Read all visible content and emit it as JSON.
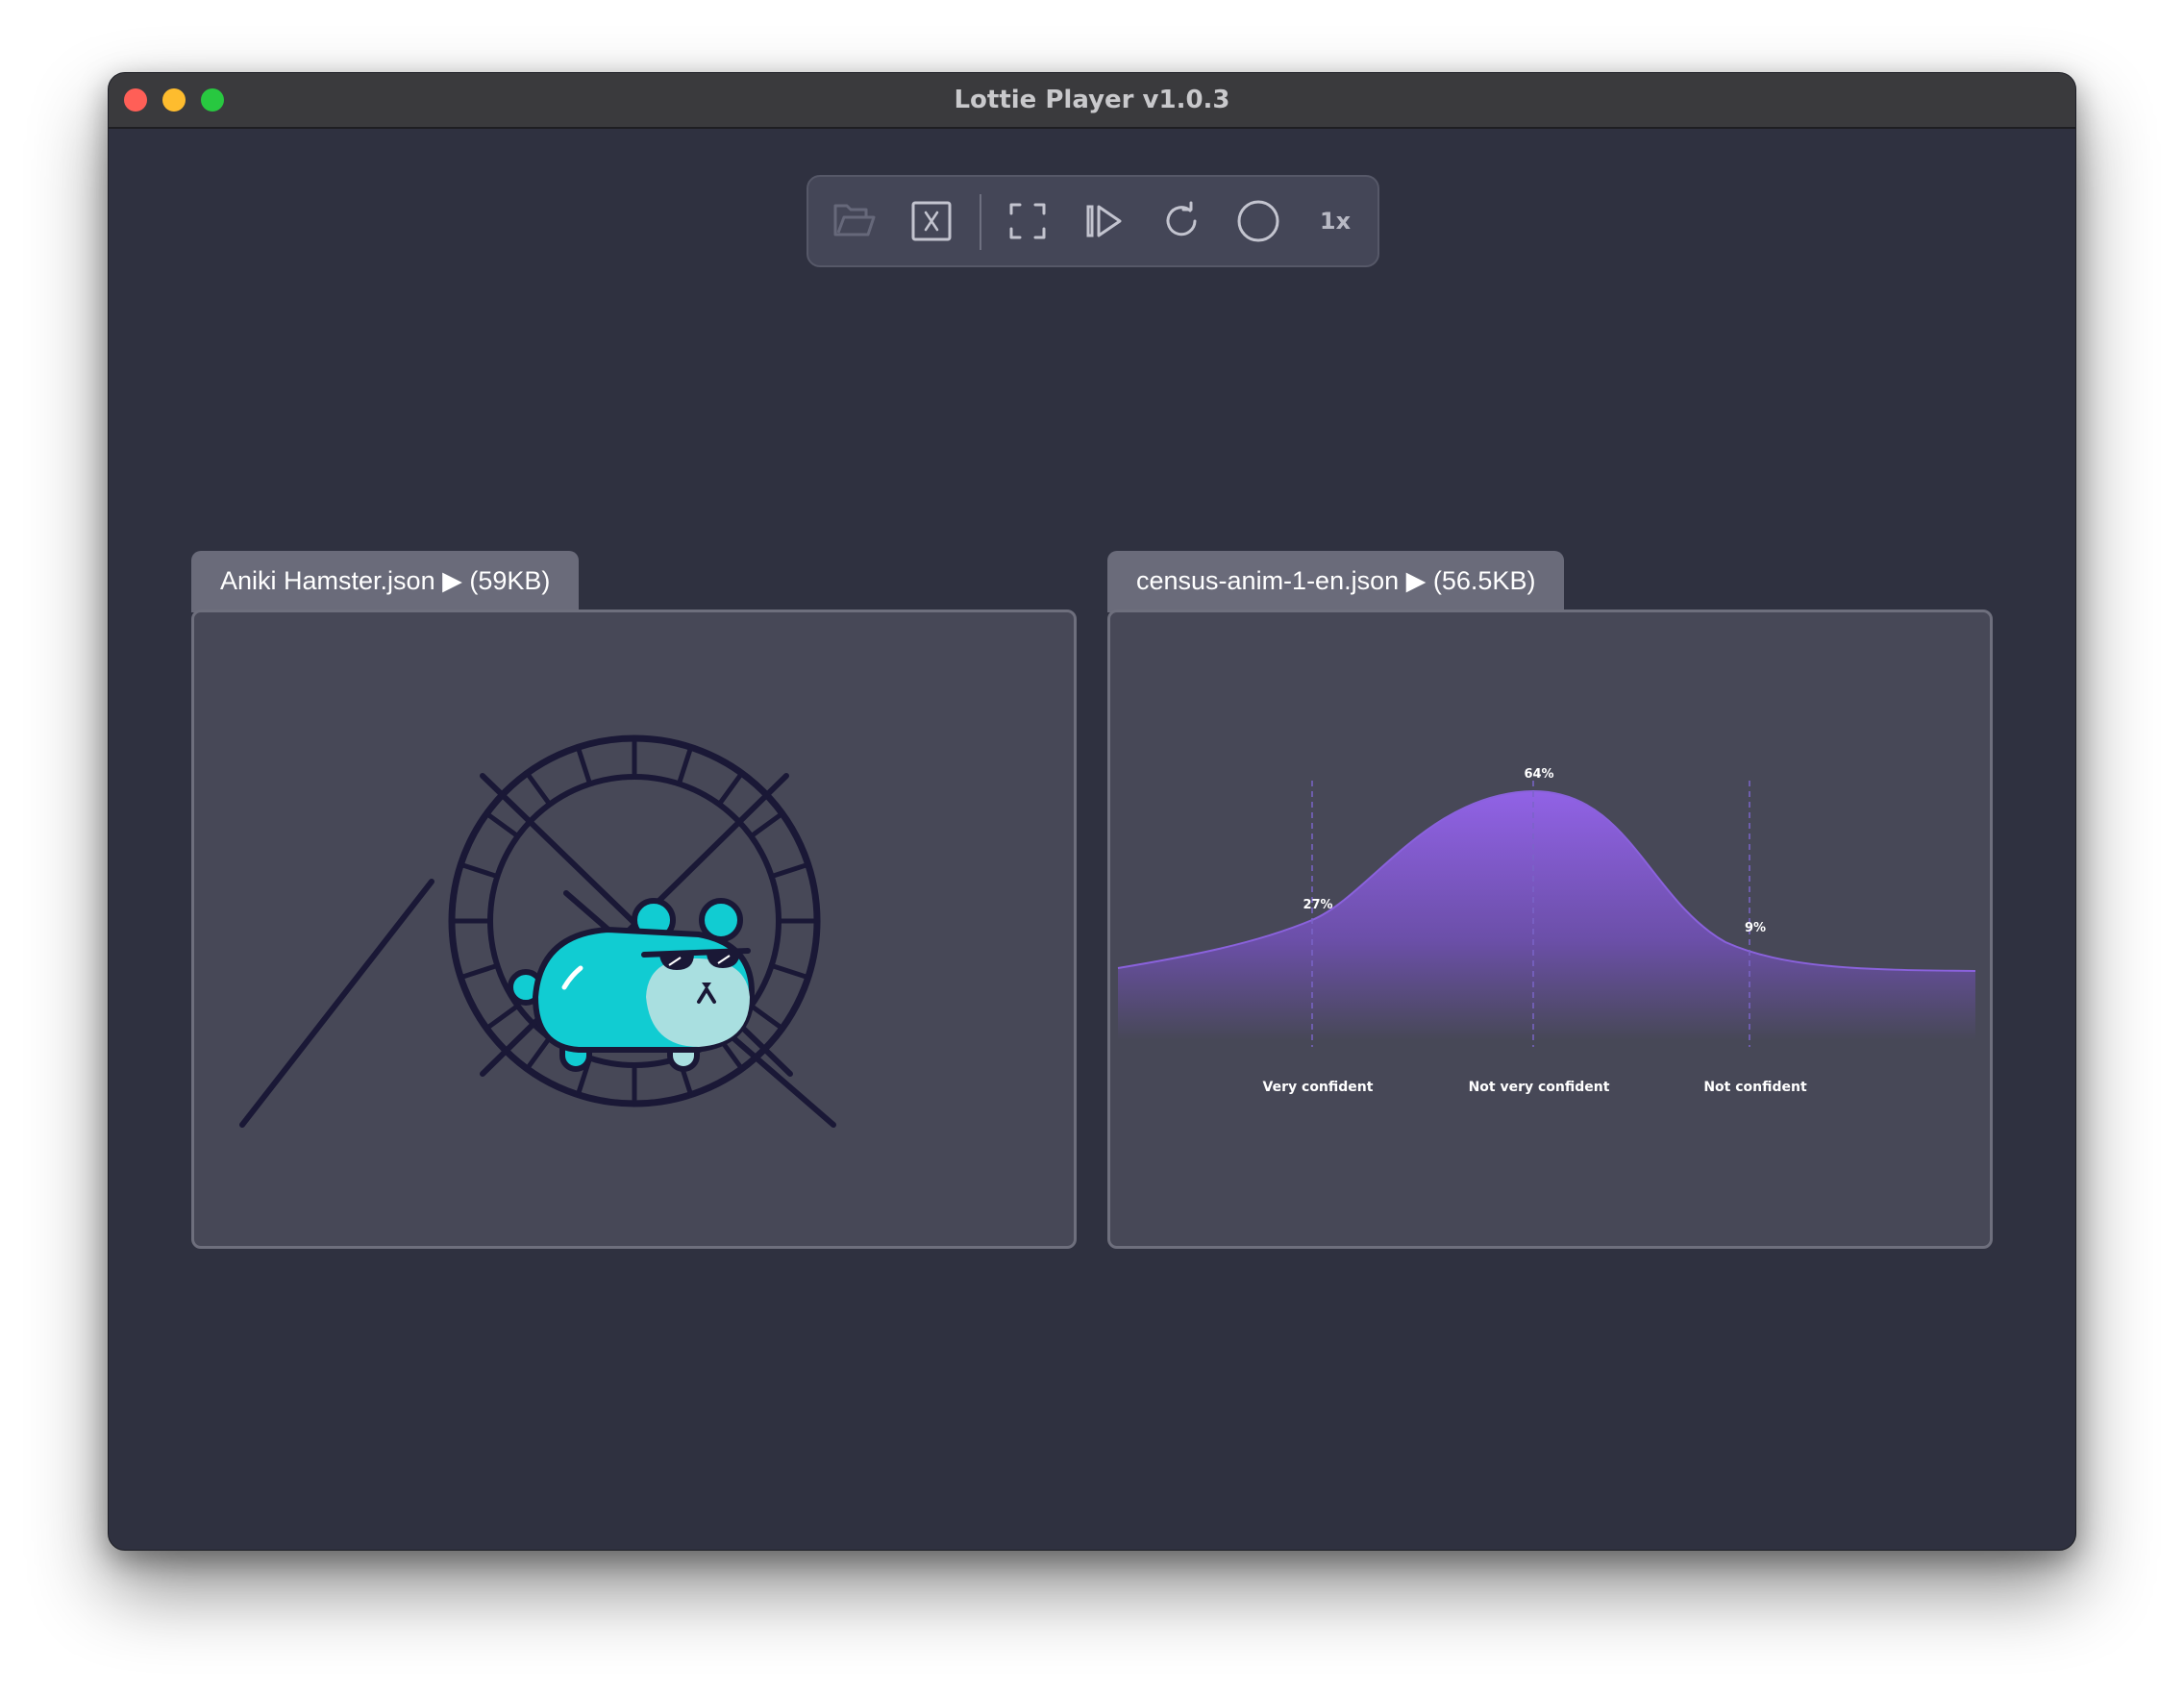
{
  "window": {
    "title": "Lottie Player v1.0.3"
  },
  "toolbar": {
    "buttons": [
      {
        "icon": "folder-open-icon",
        "enabled": false
      },
      {
        "icon": "close-file-icon",
        "enabled": true
      },
      {
        "icon": "fullscreen-icon",
        "enabled": true
      },
      {
        "icon": "step-forward-icon",
        "enabled": true
      },
      {
        "icon": "refresh-icon",
        "enabled": true
      },
      {
        "icon": "record-circle-icon",
        "enabled": true
      }
    ],
    "speed_label": "1x"
  },
  "tabs": [
    {
      "label": "Aniki Hamster.json ▶ (59KB)"
    },
    {
      "label": "census-anim-1-en.json ▶ (56.5KB)"
    }
  ],
  "colors": {
    "window_bg": "#2f3140",
    "panel_bg": "#474857",
    "tab_bg": "#6a6b7a",
    "hamster": "#11ccd2",
    "hamster_belly": "#a9dfe0",
    "wheel": "#1a1836",
    "chart_purple": "#8a62dc"
  },
  "chart_data": {
    "type": "area",
    "points": [
      {
        "label": "Very confident",
        "value_label": "27%",
        "value": 27
      },
      {
        "label": "Not very confident",
        "value_label": "64%",
        "value": 64
      },
      {
        "label": "Not confident",
        "value_label": "9%",
        "value": 9
      }
    ],
    "grid": false
  }
}
